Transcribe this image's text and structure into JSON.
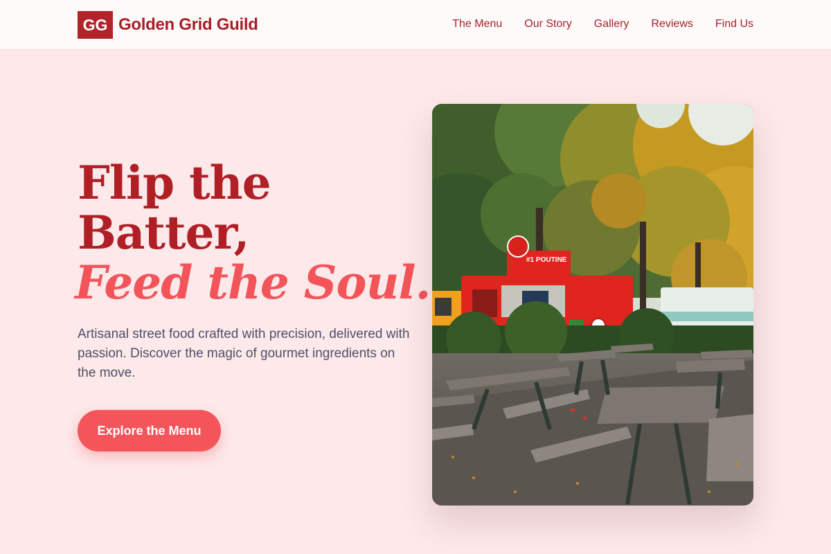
{
  "brand": {
    "logo_text": "GG",
    "name": "Golden Grid Guild"
  },
  "nav": {
    "items": [
      "The Menu",
      "Our Story",
      "Gallery",
      "Reviews",
      "Find Us"
    ]
  },
  "hero": {
    "headline_line1": "Flip the",
    "headline_line2": "Batter,",
    "headline_accent": "Feed the Soul.",
    "lead": "Artisanal street food crafted with precision, delivered with passion. Discover the magic of gourmet ingredients on the move.",
    "cta_label": "Explore the Menu"
  },
  "image": {
    "truck_sign": "#1 POUTINE"
  },
  "colors": {
    "page_background": "#fde8ea",
    "brand_red": "#b01f26",
    "accent_coral": "#f4555a",
    "body_text": "#4d5068"
  }
}
